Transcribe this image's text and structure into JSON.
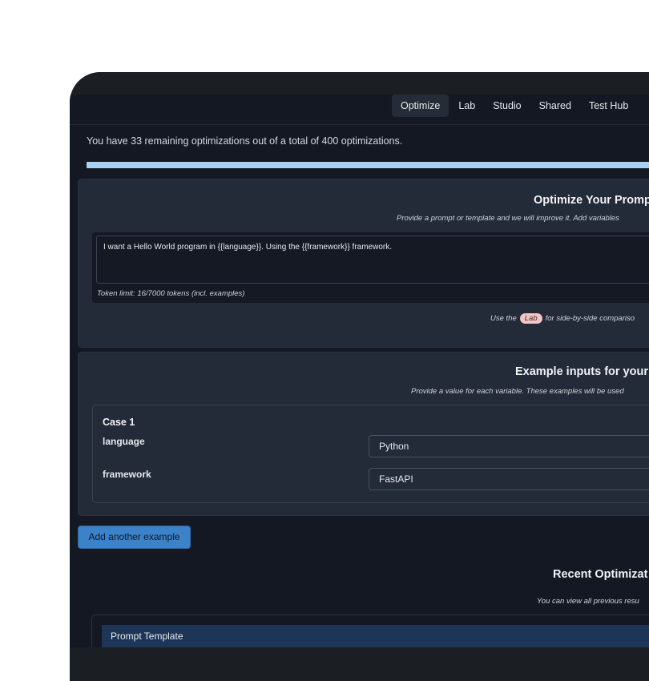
{
  "nav": {
    "tabs": [
      "Optimize",
      "Lab",
      "Studio",
      "Shared",
      "Test Hub"
    ],
    "active": "Optimize"
  },
  "notice": "You have 33 remaining optimizations out of a total of 400 optimizations.",
  "quota": {
    "remaining": 33,
    "total": 400
  },
  "optimize_card": {
    "title": "Optimize Your Promp",
    "subtitle": "Provide a prompt or template and we will improve it. Add variables",
    "prompt_value": "I want a Hello World program in {{language}}. Using the {{framework}} framework.",
    "token_limit": "Token limit: 16/7000 tokens (incl. examples)",
    "hint_before": "Use the",
    "hint_pill": "Lab",
    "hint_after": "for side-by-side compariso"
  },
  "examples_card": {
    "title": "Example inputs for your",
    "subtitle": "Provide a value for each variable. These examples will be used",
    "case_title": "Case 1",
    "variables": [
      {
        "label": "language",
        "value": "Python"
      },
      {
        "label": "framework",
        "value": "FastAPI"
      }
    ]
  },
  "add_example_label": "Add another example",
  "recent": {
    "title": "Recent Optimizat",
    "subtitle": "You can view all previous resu",
    "table_header": "Prompt Template"
  },
  "colors": {
    "background": "#131822",
    "card": "#232a38",
    "progress": "#a7d3f2",
    "button": "#3b82c8",
    "pill": "#f2c6c6"
  }
}
